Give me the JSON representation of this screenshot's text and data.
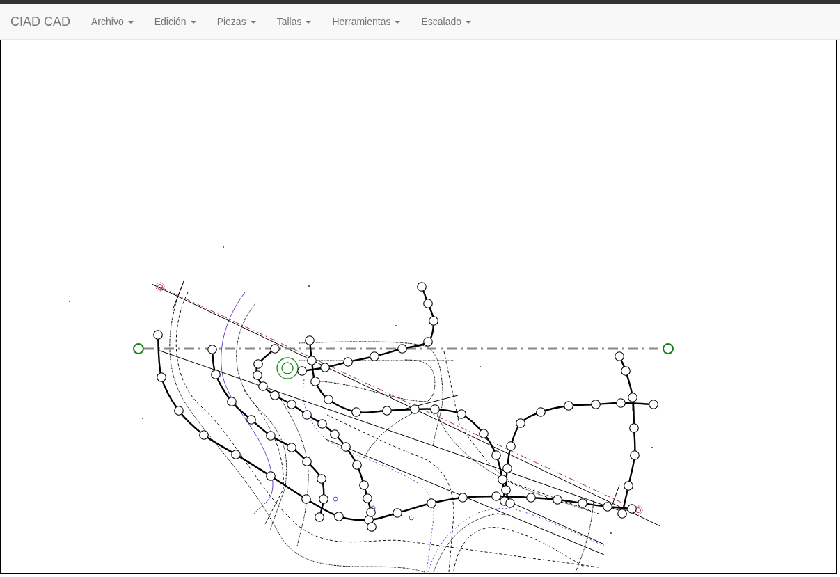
{
  "navbar": {
    "brand": "CIAD CAD",
    "menus": [
      {
        "label": "Archivo"
      },
      {
        "label": "Edición"
      },
      {
        "label": "Piezas"
      },
      {
        "label": "Tallas"
      },
      {
        "label": "Herramientas"
      },
      {
        "label": "Escalado"
      }
    ]
  }
}
